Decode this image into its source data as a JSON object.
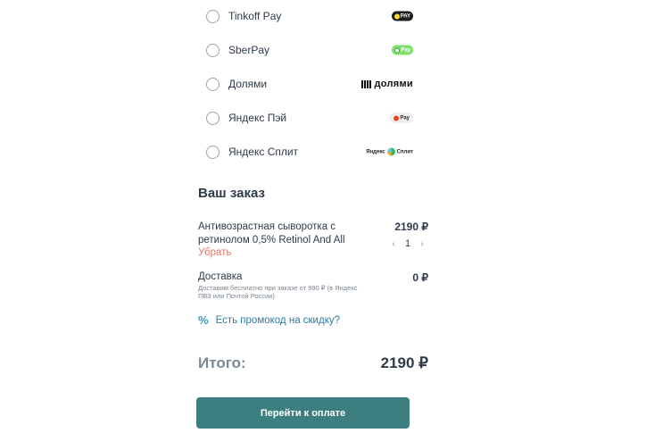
{
  "payment_methods": [
    {
      "label": "Tinkoff Pay",
      "logo_icon": "tinkoff-pay-logo-icon",
      "logo_text": "PAY"
    },
    {
      "label": "SberPay",
      "logo_icon": "sberpay-logo-icon",
      "logo_text": "Pay"
    },
    {
      "label": "Долями",
      "logo_icon": "dolyami-logo-icon",
      "logo_text": "долями"
    },
    {
      "label": "Яндекс Пэй",
      "logo_icon": "yandex-pay-logo-icon",
      "logo_text": "Pay"
    },
    {
      "label": "Яндекс Сплит",
      "logo_icon": "yandex-split-logo-icon",
      "logo_text": "Яндекс",
      "logo_text2": "Сплит"
    }
  ],
  "order": {
    "title": "Ваш заказ",
    "item": {
      "name": "Антивозрастная сыворотка с ретинолом 0,5% Retinol And All",
      "price": "2190 ₽",
      "quantity": "1",
      "remove_label": "Убрать",
      "decrement_icon": "‹",
      "increment_icon": "›"
    },
    "delivery": {
      "label": "Доставка",
      "note": "Доставим бесплатно при заказе от 990 ₽ (в Яндекс ПВЗ или Почтой России)",
      "price": "0 ₽"
    },
    "promo": {
      "icon": "%",
      "label": "Есть промокод на скидку?"
    },
    "total": {
      "label": "Итого:",
      "value": "2190 ₽"
    },
    "checkout_button": "Перейти к оплате"
  },
  "colors": {
    "accent": "#3d7f80",
    "remove_link": "#e07a6a",
    "promo_link": "#2d7aa0",
    "text": "#2e3a4a",
    "muted": "#7b8894"
  }
}
